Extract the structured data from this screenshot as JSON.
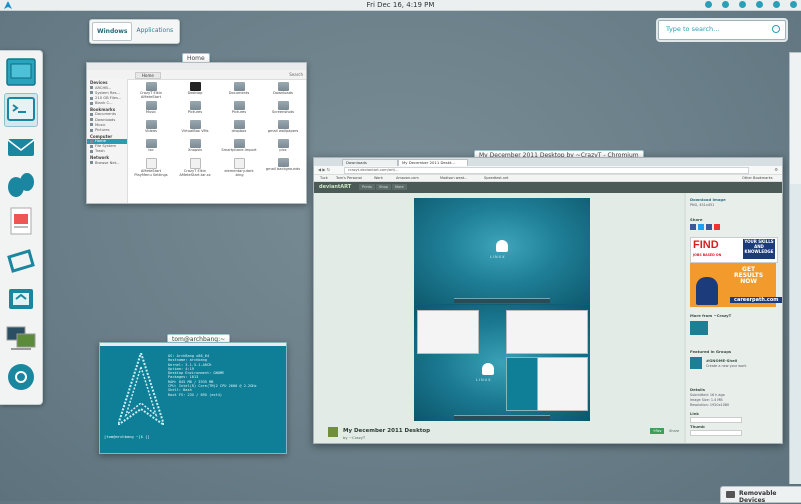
{
  "top_panel": {
    "clock": "Fri Dec 16,  4:19 PM"
  },
  "overview": {
    "tabs": [
      "Windows",
      "Applications"
    ],
    "search_placeholder": "Type to search..."
  },
  "dock": {
    "items": [
      "workspace-switcher",
      "terminal",
      "mail",
      "empathy",
      "office",
      "vpn",
      "network-manager",
      "remote-desktop",
      "chromium"
    ]
  },
  "windows": {
    "home": {
      "label": "Home",
      "path": "Home",
      "search": "Search",
      "sidebar": [
        {
          "head": "Devices"
        },
        {
          "item": "ARCHB..."
        },
        {
          "item": "System Res..."
        },
        {
          "item": "210 GB Files..."
        },
        {
          "item": "Blank C..."
        },
        {
          "head": "Bookmarks"
        },
        {
          "item": "Documents"
        },
        {
          "item": "Downloads"
        },
        {
          "item": "Music"
        },
        {
          "item": "Pictures"
        },
        {
          "head": "Computer"
        },
        {
          "item": "Home",
          "selected": true
        },
        {
          "item": "File System"
        },
        {
          "item": "Trash"
        },
        {
          "head": "Network"
        },
        {
          "item": "Browse Net..."
        }
      ],
      "files": [
        "CrazyT Elkin\nAMeteStart",
        "Desktop",
        "Documents",
        "Downloads",
        "Music",
        "Pictures",
        "Pictures",
        "Screenshots",
        "Videos",
        "VirtualBox VMs",
        "dropbox",
        "gmail wallpapers",
        "Iso",
        "Xnopsis",
        "Smartphone.Import",
        "pics",
        "AMeteStart\nPlayMenu Settings",
        "CrazyT Elkin\nAMeteStart.tar.xz",
        "elementary.dark\n.bing",
        "gmail backgrounds"
      ]
    },
    "terminal": {
      "label": "tom@archbang:~",
      "info": "OS: ArchBang x86_64\nHostname: archbang\nKernel: 3.1.5-1-ARCH\nUptime: 4:19\nDesktop Environment: GNOME\nPackages: 1013\nRAM: 845 MB / 3935 MB\nCPU: Intel(R) Core(TM)2 CPU 2600 @ 2.2GHz\nShell: Bash\nRoot FS: 23G / 89G (ext4)",
      "prompt": "[tom@archbang ~]$ []"
    },
    "chromium": {
      "label": "My December 2011 Desktop by ~CrazyT - Chromium",
      "tabs": [
        "Downloads",
        "My December 2011 Deskt..."
      ],
      "url": "crazyt.deviantart.com/art/...",
      "bookmarks": [
        "Tuck",
        "Tom's Personal",
        "Work",
        "Amazon.com",
        "Madison weat...",
        "Speedtest.net",
        "Other Bookmarks"
      ],
      "deviantart": {
        "logo": "deviantART",
        "nav": [
          "Prints",
          "Shop",
          "More"
        ],
        "art_title": "My December 2011 Desktop",
        "by": "by ~CrazyT",
        "fav_button": "+Fav",
        "share_link": "Share",
        "right": {
          "download": "Download Image",
          "download_sub": "PNG, 451x451",
          "share_head": "Share",
          "more_from": "More from ~CrazyT",
          "featured": "Featured in Groups",
          "featured_group": "#GNOME-Shell",
          "featured_sub": "Create a new your work",
          "details": "Details",
          "details_lines": [
            "Submitted: 16 h ago",
            "Image Size: 1.4 MB",
            "Resolution: 1920x1080"
          ],
          "link_head": "Link",
          "thumb_head": "Thumb"
        },
        "ads": {
          "find": "FIND",
          "your": "YOUR SKILLS AND KNOWLEDGE",
          "jobs": "JOBS BASED ON",
          "get": "GET\nRESULTS\nNOW",
          "careerpath": "careerpath.com"
        },
        "wallpaper_brand": "LINUX"
      }
    }
  },
  "removable_devices": "Removable Devices"
}
